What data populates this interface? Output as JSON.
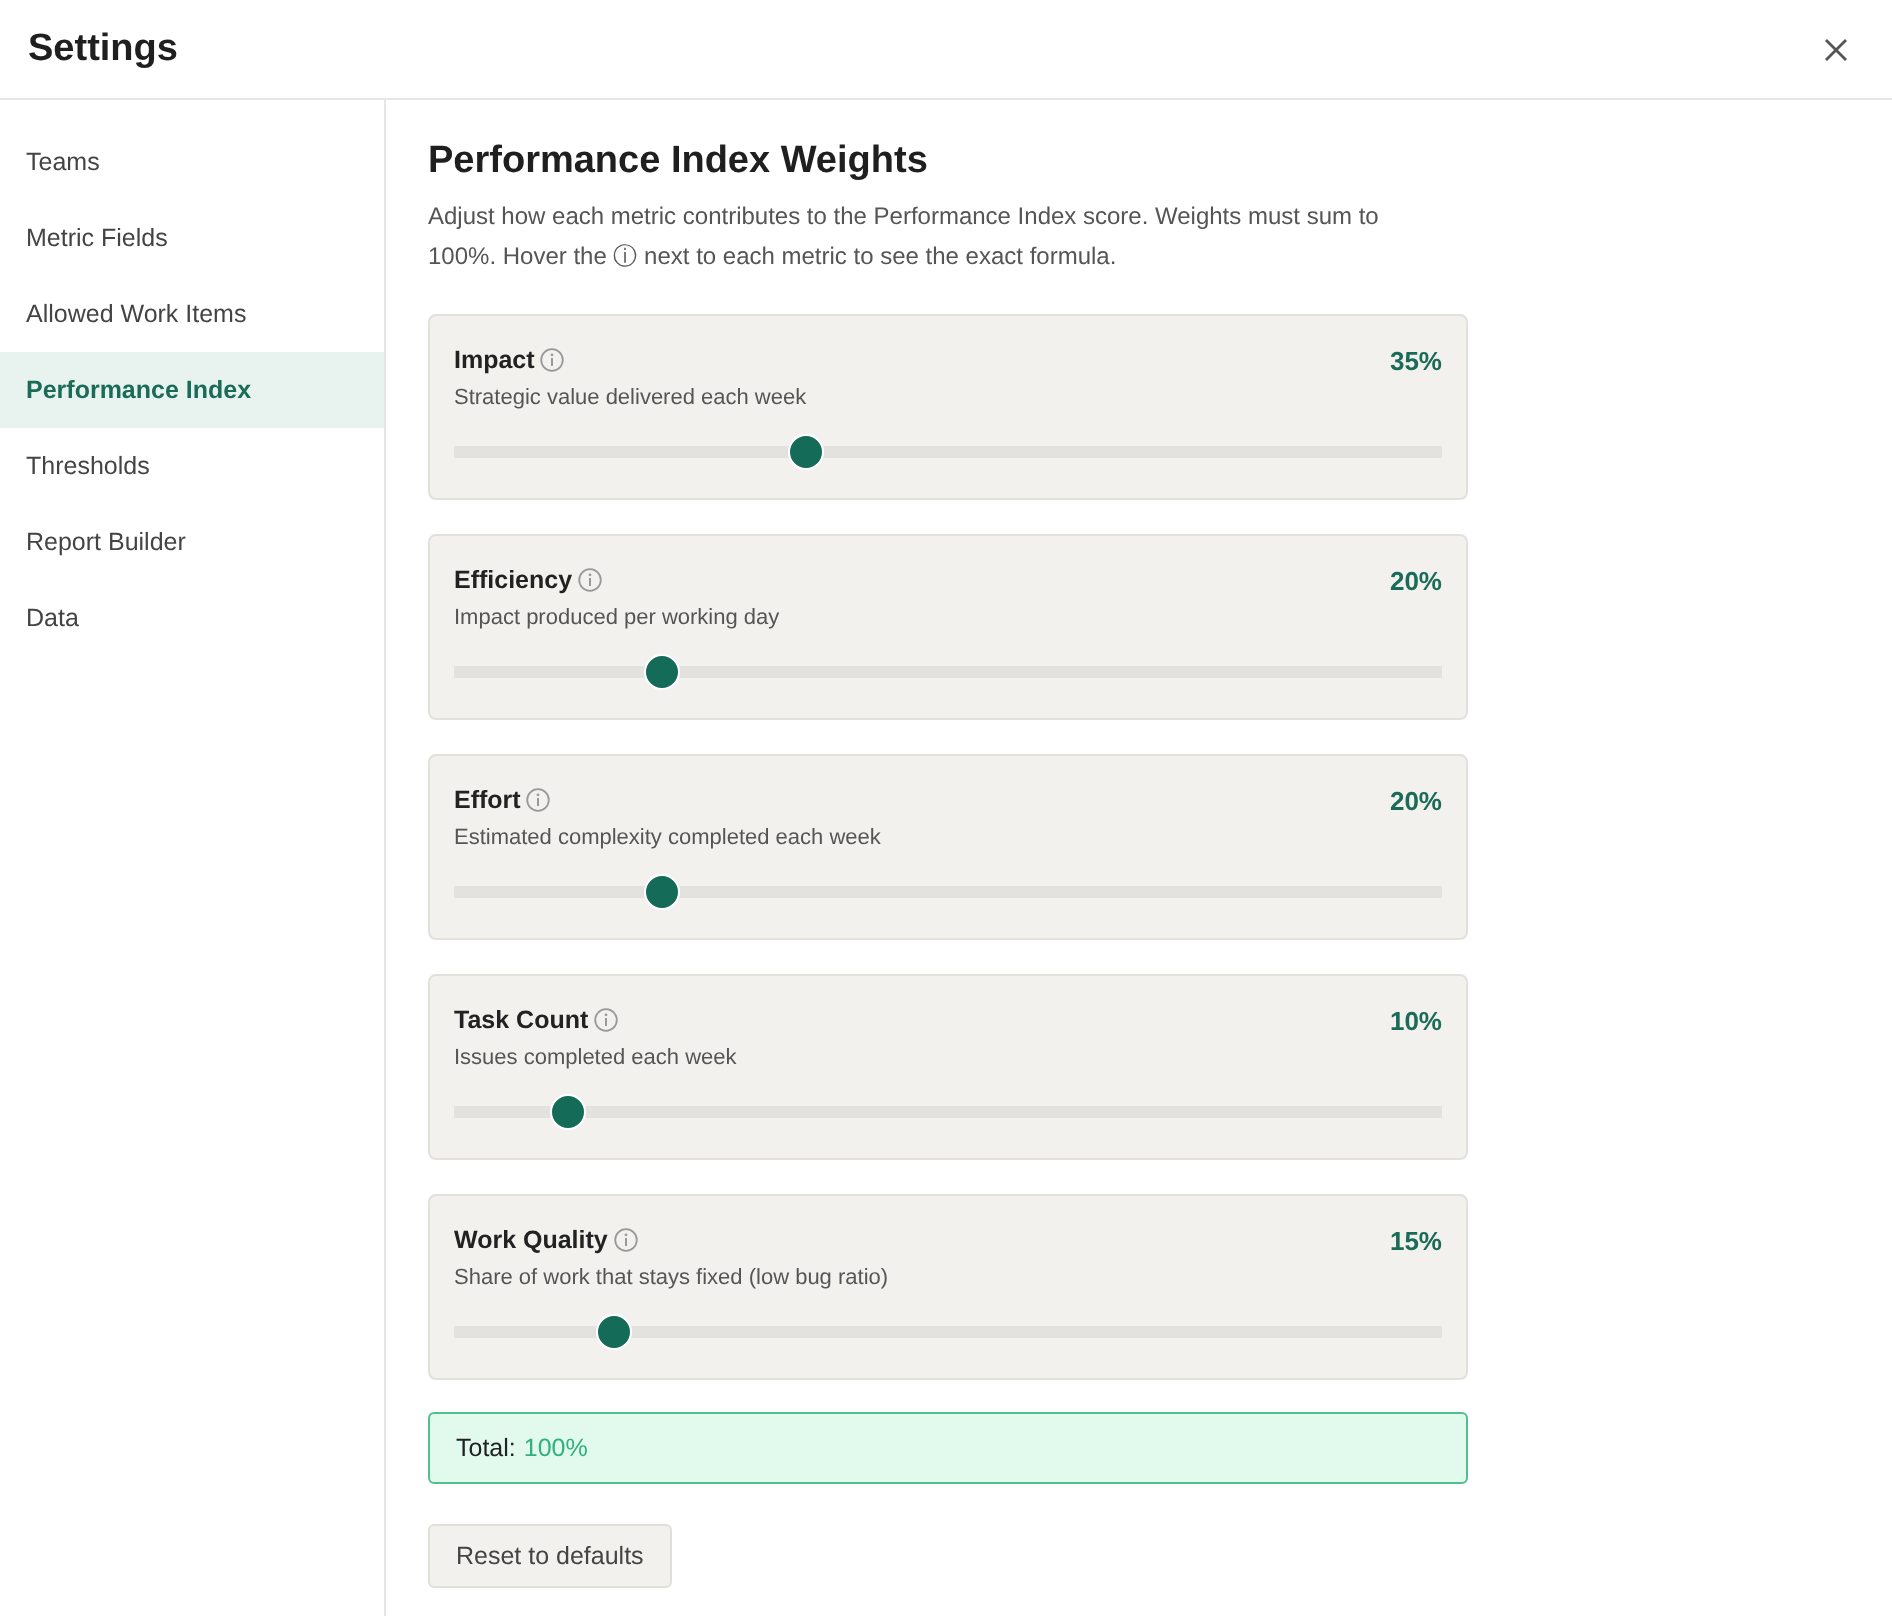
{
  "window": {
    "title": "Settings"
  },
  "sidebar": {
    "items": [
      {
        "label": "Teams",
        "selected": false
      },
      {
        "label": "Metric Fields",
        "selected": false
      },
      {
        "label": "Allowed Work Items",
        "selected": false
      },
      {
        "label": "Performance Index",
        "selected": true
      },
      {
        "label": "Thresholds",
        "selected": false
      },
      {
        "label": "Report Builder",
        "selected": false
      },
      {
        "label": "Data",
        "selected": false
      }
    ]
  },
  "content": {
    "title": "Performance Index Weights",
    "description": "Adjust how each metric contributes to the Performance Index score. Weights must sum to 100%. Hover the ⓘ next to each metric to see the exact formula.",
    "metrics": [
      {
        "name": "Impact",
        "description": "Strategic value delivered each week",
        "reading": "35%",
        "level": 0.35
      },
      {
        "name": "Efficiency",
        "description": "Impact produced per working day",
        "reading": "20%",
        "level": 0.2
      },
      {
        "name": "Effort",
        "description": "Estimated complexity completed each week",
        "reading": "20%",
        "level": 0.2
      },
      {
        "name": "Task Count",
        "description": "Issues completed each week",
        "reading": "10%",
        "level": 0.1
      },
      {
        "name": "Work Quality",
        "description": "Share of work that stays fixed (low bug ratio)",
        "reading": "15%",
        "level": 0.15
      }
    ],
    "total": {
      "label": "Total:",
      "value": "100%"
    },
    "reset_button": "Reset to defaults"
  }
}
